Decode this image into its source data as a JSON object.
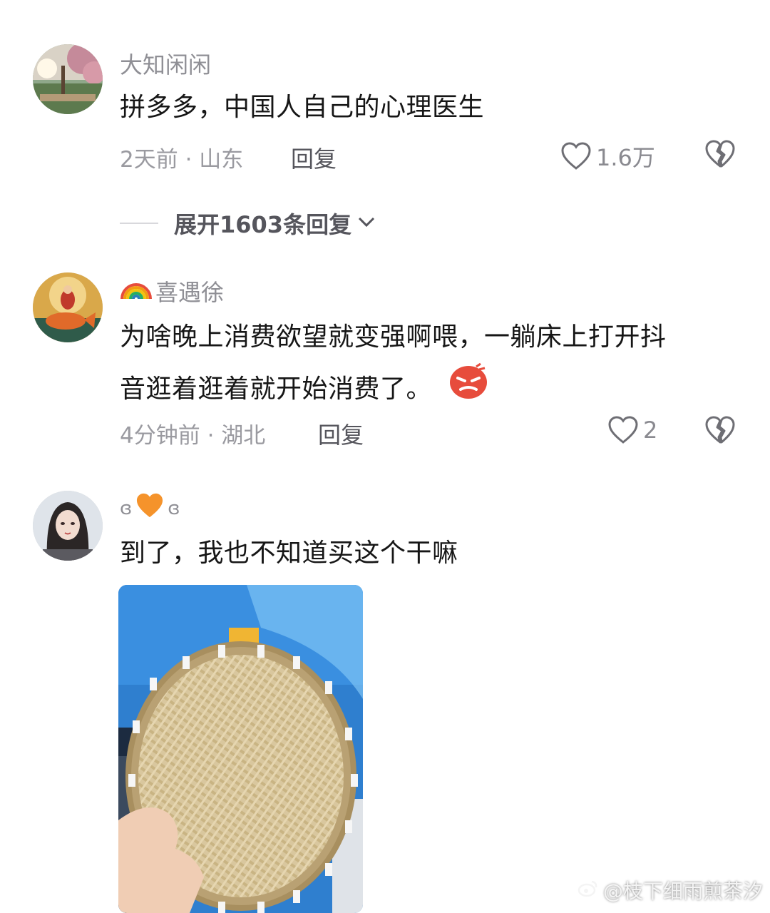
{
  "comments": [
    {
      "username": "大知闲闲",
      "text": "拼多多，中国人自己的心理医生",
      "meta": "2天前 · 山东",
      "reply_label": "回复",
      "like_count": "1.6万",
      "expand_label": "展开1603条回复"
    },
    {
      "username_prefix_emoji": "🌈",
      "username": "喜遇徐",
      "text_line1": "为啥晚上消费欲望就变强啊喂，一躺床上打开抖",
      "text_line2": "音逛着逛着就开始消费了。",
      "emoji": "angry-face",
      "meta": "4分钟前 · 湖北",
      "reply_label": "回复",
      "like_count": "2"
    },
    {
      "username_left": "ɞ",
      "username_heart_emoji": "🧡",
      "username_right": "ɞ",
      "text": "到了，我也不知道买这个干嘛",
      "image": "bamboo-sieve-photo"
    }
  ],
  "watermark": "@枝下细雨煎茶汐",
  "colors": {
    "primary_text": "#161616",
    "secondary_text": "#8f8f95",
    "action_text": "#55555c"
  }
}
